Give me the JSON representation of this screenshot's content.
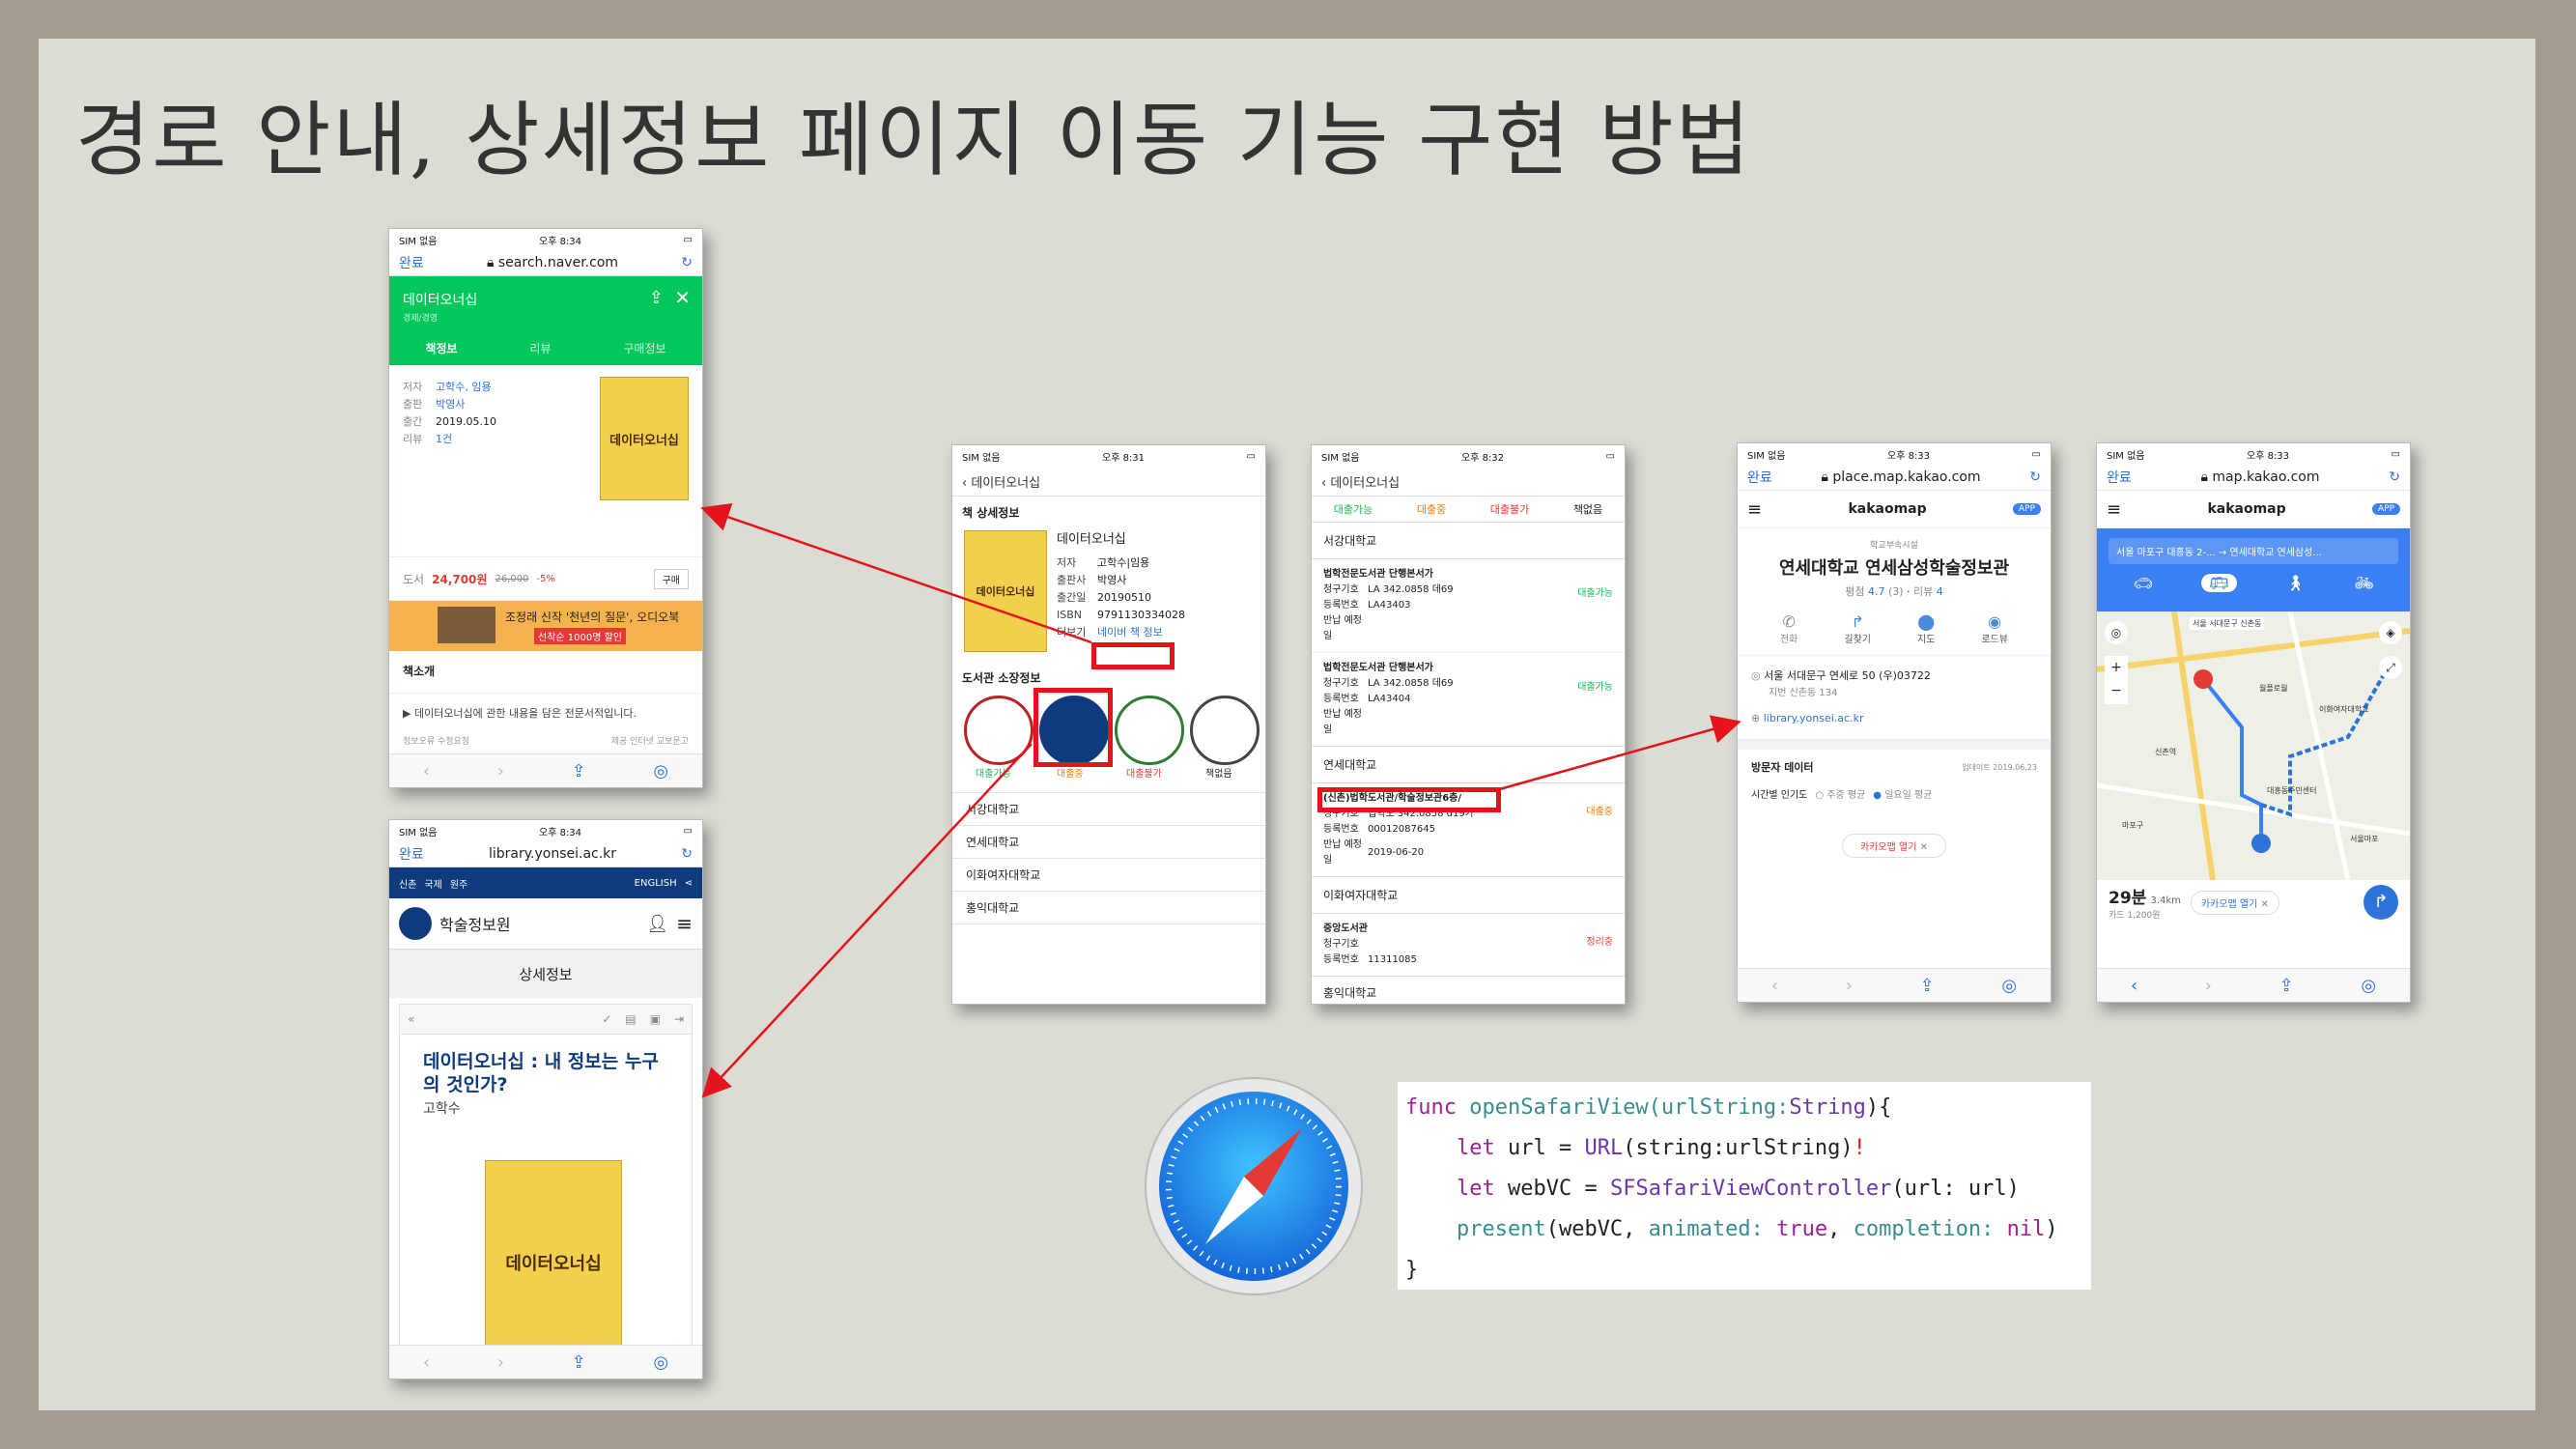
{
  "slide": {
    "title": "경로 안내, 상세정보 페이지 이동 기능 구현 방법"
  },
  "phone_naver": {
    "status": {
      "carrier": "SIM 없음 ",
      "time": "오후 8:34"
    },
    "urlbar": {
      "done": "완료",
      "url": "search.naver.com"
    },
    "header": {
      "title": "데이터오너십",
      "subtitle": "경제/경영"
    },
    "tabs": [
      "책정보",
      "리뷰",
      "구매정보"
    ],
    "info": [
      {
        "k": "저자",
        "v": "고학수, 임용"
      },
      {
        "k": "출판",
        "v": "박영사"
      },
      {
        "k": "출간",
        "v": "2019.05.10"
      },
      {
        "k": "리뷰",
        "v": "1건"
      }
    ],
    "cover_title": "데이터오너십",
    "price": {
      "label": "도서",
      "price": "24,700원",
      "original": "26,000",
      "discount": "-5%",
      "buy": "구매"
    },
    "banner": {
      "text": "조정래 신작 '천년의 질문', 오디오북",
      "sub": "선착순 1000명 할인"
    },
    "intro_title": "책소개",
    "intro_text": "▶ 데이터오너십에 관한 내용을 담은 전문서적입니다.",
    "footer_left": "정보오류 수정요청",
    "footer_right": "제공 인터넷 교보문고"
  },
  "phone_yonsei": {
    "status": {
      "carrier": "SIM 없음 ",
      "time": "오후 8:34"
    },
    "urlbar": {
      "done": "완료",
      "url": "library.yonsei.ac.kr"
    },
    "topnav": {
      "items": [
        "신촌 ",
        "국제",
        "원주"
      ],
      "english": "ENGLISH"
    },
    "brand": "학술정보원",
    "section": "상세정보",
    "book_title": "데이터오너십 : 내 정보는 누구의 것인가?",
    "author": "고학수",
    "cover_title": "데이터오너십"
  },
  "phone_detail": {
    "status": {
      "carrier": "SIM 없음 ",
      "time": "오후 8:31"
    },
    "back": "데이터오너십",
    "section_title": "책 상세정보",
    "book_title": "데이터오너십",
    "info": [
      {
        "k": "저자",
        "v": "고학수|임용"
      },
      {
        "k": "출판사",
        "v": "박영사"
      },
      {
        "k": "출간일",
        "v": "20190510"
      },
      {
        "k": "ISBN",
        "v": "9791130334028"
      },
      {
        "k": "더보기",
        "v": "네이버 책 정보"
      }
    ],
    "libraries_title": "도서관 소장정보",
    "seals": [
      {
        "status": "대출가능",
        "color": "#1db954"
      },
      {
        "status": "대출중",
        "color": "#f07b00"
      },
      {
        "status": "대출불가",
        "color": "#e53935"
      },
      {
        "status": "책없음",
        "color": "#222222"
      }
    ],
    "universities": [
      "서강대학교",
      "연세대학교",
      "이화여자대학교",
      "홍익대학교"
    ]
  },
  "phone_status": {
    "status": {
      "carrier": "SIM 없음 ",
      "time": "오후 8:32"
    },
    "back": "데이터오너십",
    "legend": [
      "대출가능",
      "대출중",
      "대출불가",
      "책없음"
    ],
    "groups": [
      {
        "univ": "서강대학교",
        "items": [
          {
            "loc": "법학전문도서관 단행본서가",
            "call": "LA 342.0858 데69",
            "reg": "LA43403",
            "due": "",
            "status": "대출가능"
          },
          {
            "loc": "법학전문도서관 단행본서가",
            "call": "LA 342.0858 데69",
            "reg": "LA43404",
            "due": "",
            "status": "대출가능"
          }
        ]
      },
      {
        "univ": "연세대학교",
        "items": [
          {
            "loc": "(신촌)법학도서관/학술정보관6층/",
            "call": "법학도 342.0858 d19가",
            "reg": "00012087645",
            "due": "2019-06-20",
            "status": "대출중"
          }
        ]
      },
      {
        "univ": "이화여자대학교",
        "items": []
      },
      {
        "univ": "중앙도서관",
        "items": [
          {
            "loc": "",
            "call": "",
            "reg": "11311085",
            "due": "",
            "status": "정리중"
          }
        ]
      }
    ],
    "labels": {
      "call": "청구기호",
      "reg": "등록번호",
      "due": "반납 예정일"
    },
    "last_univ": "홍익대학교"
  },
  "phone_place": {
    "status": {
      "carrier": "SIM 없음 ",
      "time": "오후 8:33"
    },
    "urlbar": {
      "done": "완료",
      "url": "place.map.kakao.com"
    },
    "brand": "kakaomap",
    "app_badge": "APP",
    "category": "학교부속시설",
    "name": "연세대학교 연세삼성학술정보관",
    "rating_label": "평점",
    "rating": "4.7",
    "rating_count": "(3)",
    "review_label": "리뷰",
    "review": "4",
    "actions": [
      "전화",
      "길찾기",
      "지도",
      "로드뷰"
    ],
    "address": "서울 서대문구 연세로 50 (우)03722",
    "jibun": "지번  신촌동 134",
    "website": "library.yonsei.ac.kr",
    "visitor_title": "방문자 데이터",
    "visitor_date": "업데이트 2019.06.23",
    "popularity_label": "시간별 인기도",
    "popularity_legend": [
      "주중 평균",
      "일요일 평균"
    ],
    "open_app": "카카오맵 열기"
  },
  "phone_map": {
    "status": {
      "carrier": "SIM 없음 ",
      "time": "오후 8:33"
    },
    "urlbar": {
      "done": "완료",
      "url": "map.kakao.com"
    },
    "brand": "kakaomap",
    "app_badge": "APP",
    "route": "서울 마포구 대흥동 2-... → 연세대학교 연세삼성...",
    "duration": "29분",
    "distance": "3.4km",
    "fare": "카드 1,200원",
    "open_app": "카카오맵 열기",
    "map_labels": [
      "서울 서대문구 신촌동",
      "월플로월",
      "이화여자대학교",
      "신촌역",
      "대흥동주민센터",
      "마포구",
      "서울마포"
    ]
  },
  "code": {
    "line1_kw": "func",
    "line1_fn": "openSafariView",
    "line1_rest": "(urlString:",
    "line1_type": "String",
    "line1_end": "){",
    "line2_kw": "let",
    "line2_a": " url = ",
    "line2_type": "URL",
    "line2_b": "(string:urlString)",
    "line2_bang": "!",
    "line3_kw": "let",
    "line3_a": " webVC = ",
    "line3_type": "SFSafariViewController",
    "line3_b": "(url: url)",
    "line4_fn": "present",
    "line4_a": "(webVC, ",
    "line4_arg1": "animated:",
    "line4_v1": "true",
    "line4_sep": ", ",
    "line4_arg2": "completion:",
    "line4_v2": "nil",
    "line4_end": ")",
    "line5": "}"
  },
  "colors": {
    "naver_green": "#03c75a",
    "highlight_red": "#e3141b",
    "kakao_blue": "#3b7ff5",
    "yonsei_navy": "#0d3b7d"
  }
}
